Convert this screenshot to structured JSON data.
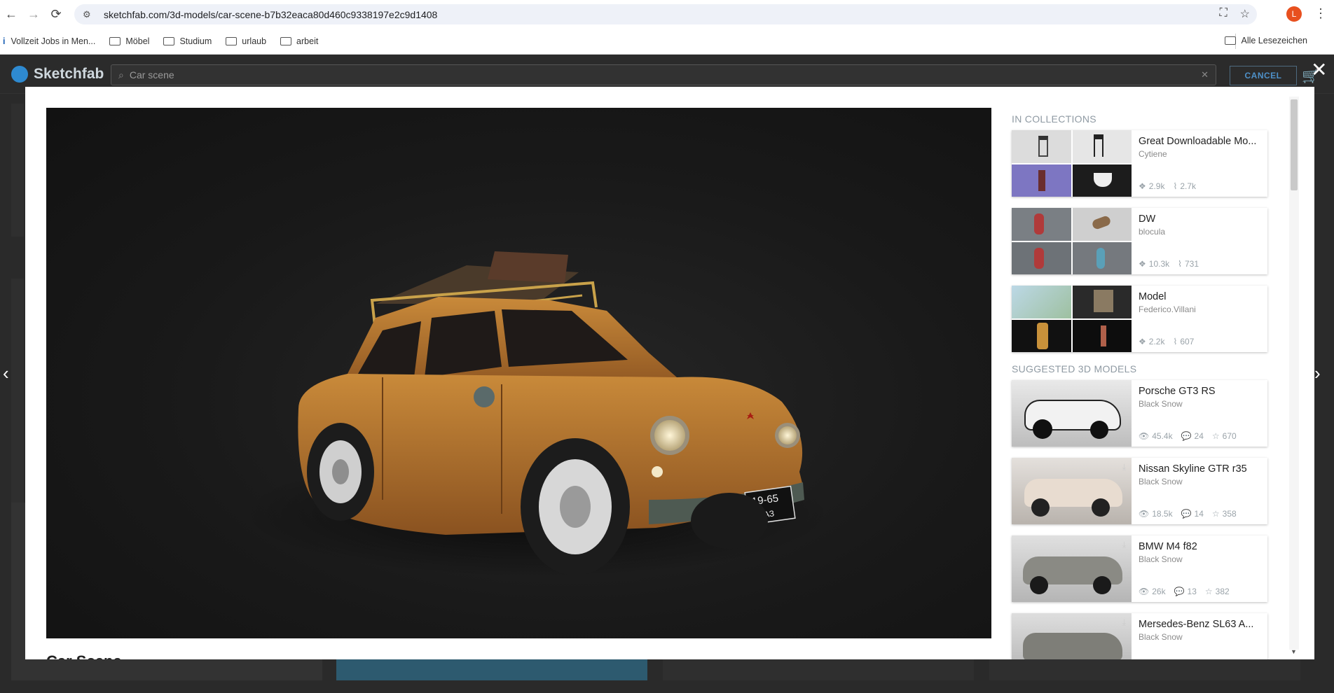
{
  "browser": {
    "url": "sketchfab.com/3d-models/car-scene-b7b32eaca80d460c9338197e2c9d1408",
    "profile_initial": "L",
    "bookmarks": [
      "Vollzeit Jobs in Men...",
      "Möbel",
      "Studium",
      "urlaub",
      "arbeit"
    ],
    "bookmarks_all": "Alle Lesezeichen"
  },
  "site": {
    "logo": "Sketchfab",
    "search_value": "Car scene",
    "cancel_label": "CANCEL"
  },
  "modal": {
    "model_title": "Car Scene",
    "in_collections_title": "IN COLLECTIONS",
    "suggested_title": "SUGGESTED 3D MODELS",
    "collections": [
      {
        "title": "Great Downloadable Mo...",
        "author": "Cytiene",
        "models": "2.9k",
        "followers": "2.7k"
      },
      {
        "title": "DW",
        "author": "blocula",
        "models": "10.3k",
        "followers": "731"
      },
      {
        "title": "Model",
        "author": "Federico.Villani",
        "models": "2.2k",
        "followers": "607"
      }
    ],
    "suggested": [
      {
        "title": "Porsche GT3 RS",
        "author": "Black Snow",
        "views": "45.4k",
        "comments": "24",
        "likes": "670"
      },
      {
        "title": "Nissan Skyline GTR r35",
        "author": "Black Snow",
        "views": "18.5k",
        "comments": "14",
        "likes": "358"
      },
      {
        "title": "BMW M4 f82",
        "author": "Black Snow",
        "views": "26k",
        "comments": "13",
        "likes": "382"
      },
      {
        "title": "Mersedes-Benz SL63 A...",
        "author": "Black Snow"
      }
    ]
  },
  "plate": {
    "line1": "19-65",
    "line2": "ЗАЗ"
  },
  "colors": {
    "accent": "#1caad9",
    "car_body": "#b9782d",
    "viewer_bg": "#1a1a1a"
  }
}
